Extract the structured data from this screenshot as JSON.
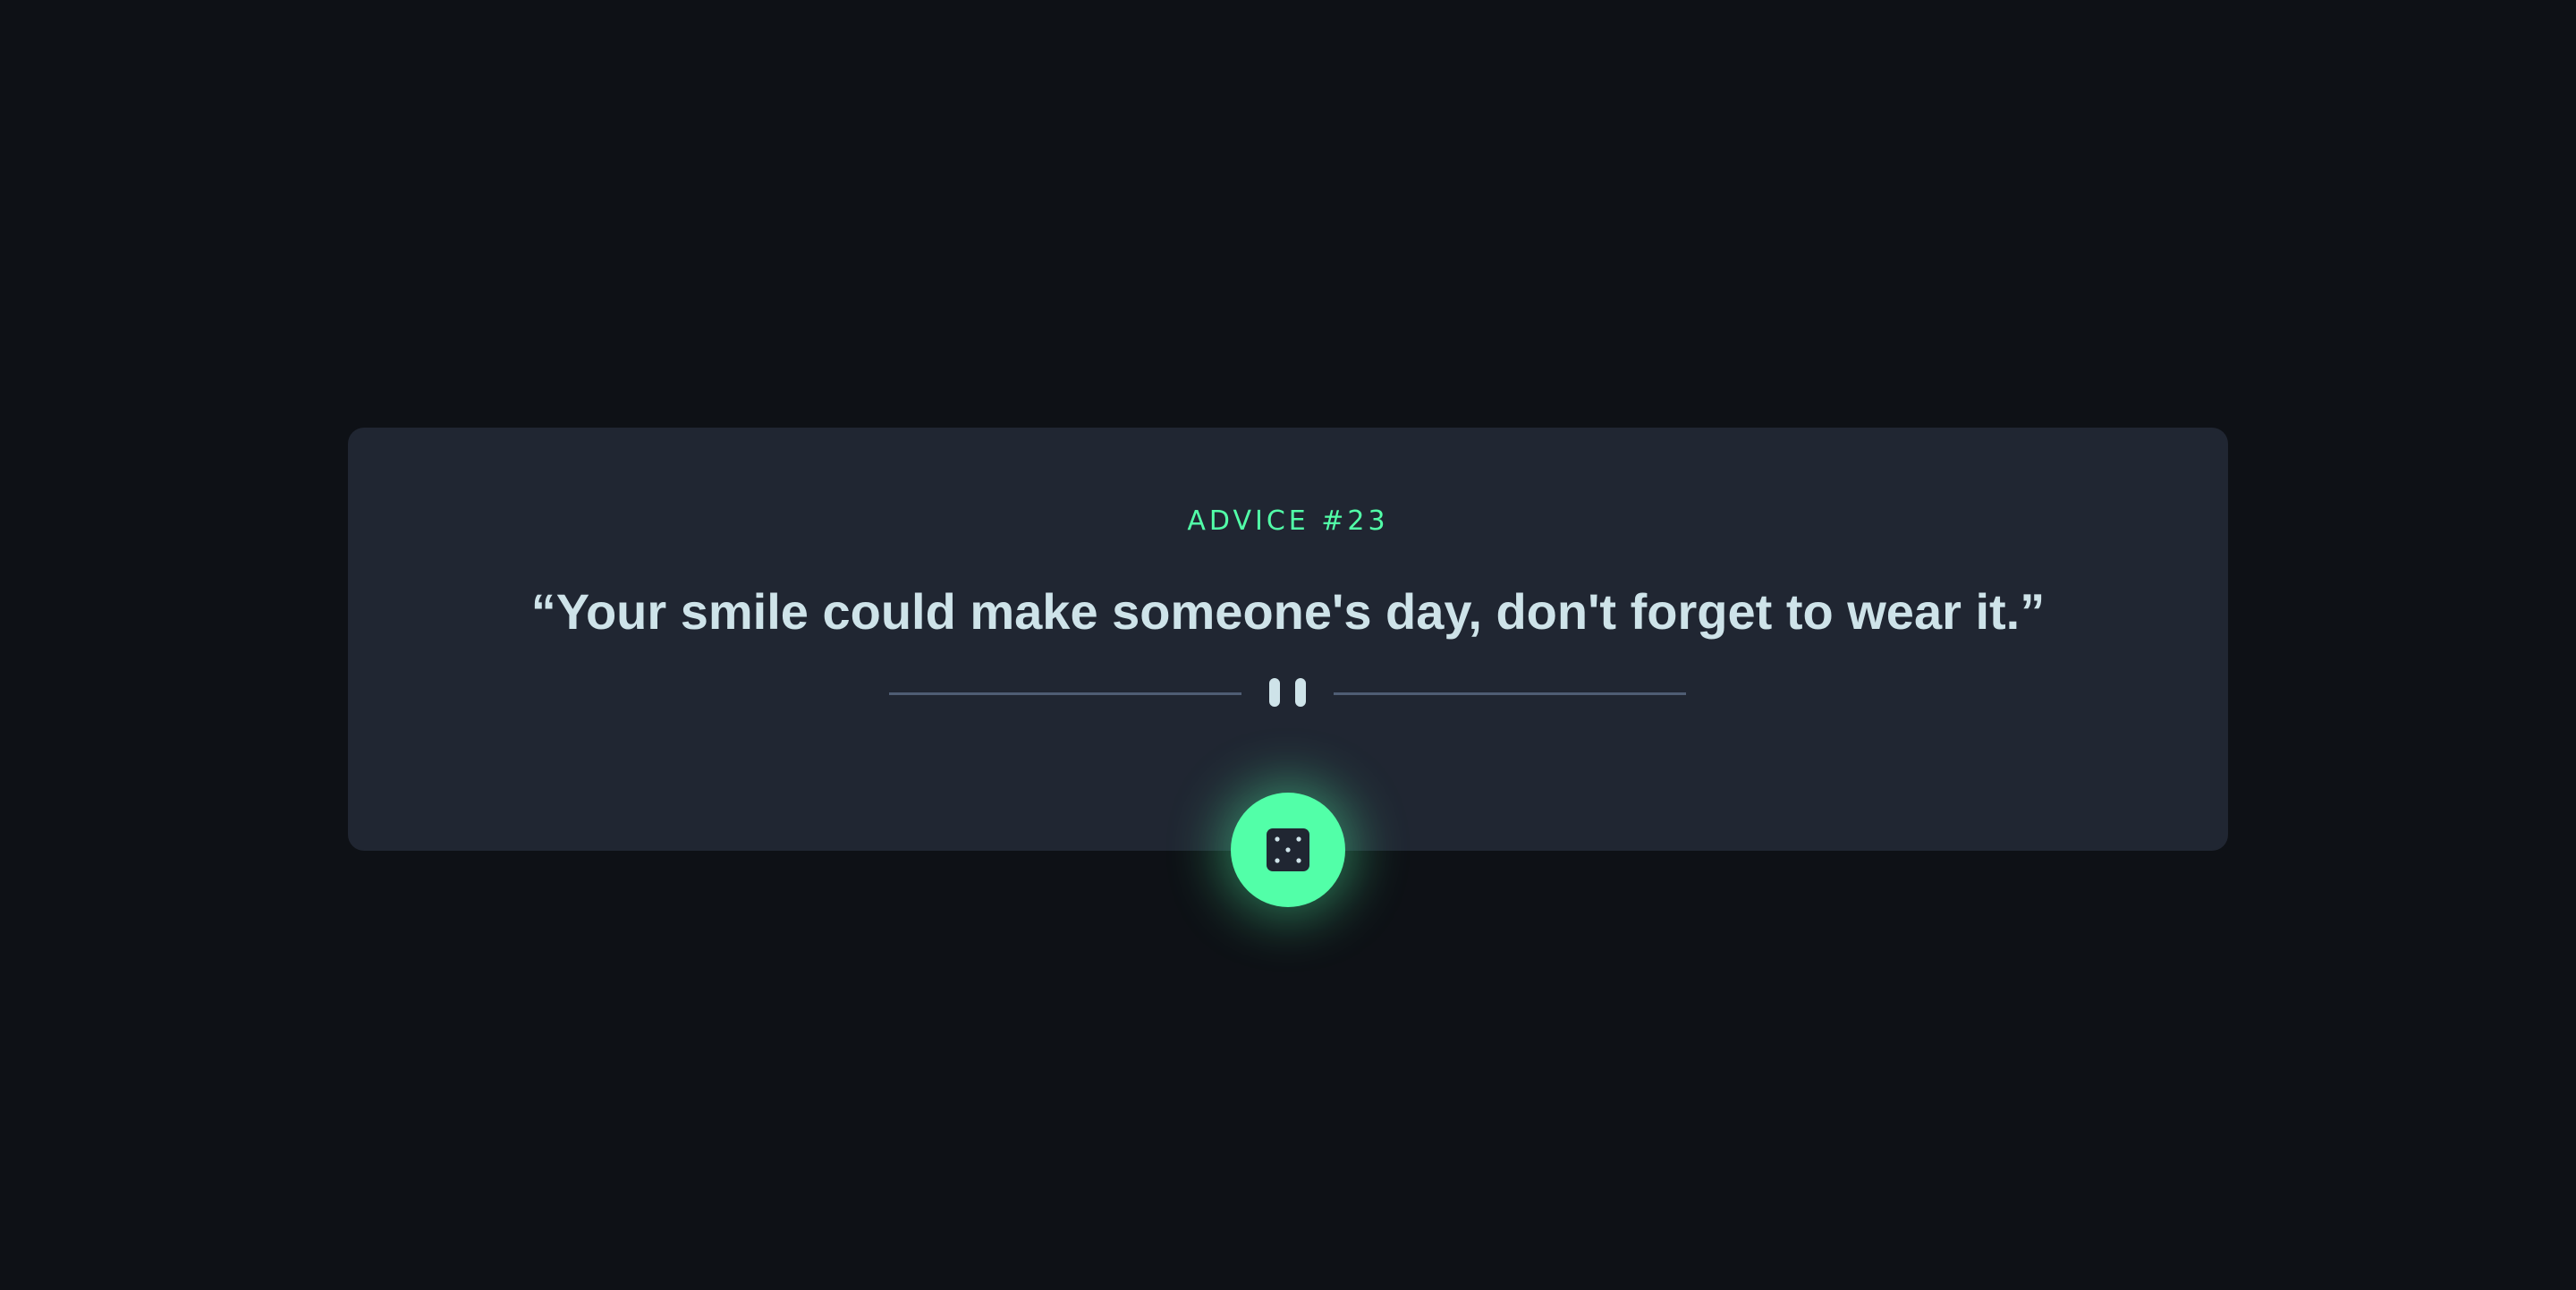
{
  "advice": {
    "label": "ADVICE #23",
    "quote": "“Your smile could make someone's day, don't forget to wear it.”"
  },
  "icons": {
    "divider": "pause-icon",
    "button": "dice-icon"
  },
  "colors": {
    "background": "#0e1116",
    "card": "#202632",
    "accent": "#52ffa8",
    "text": "#cee3e9",
    "divider": "#4f5d74"
  }
}
